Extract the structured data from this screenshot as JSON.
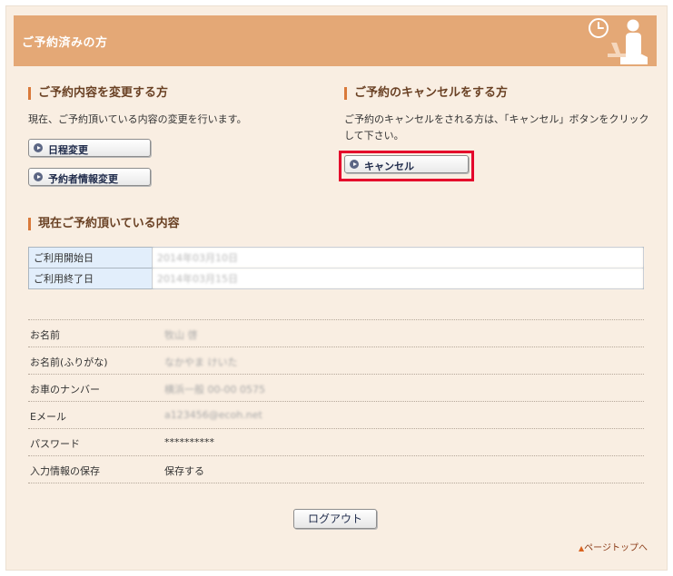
{
  "header": {
    "title": "ご予約済みの方",
    "icon": "seated-person-clock-icon"
  },
  "change_section": {
    "title": "ご予約内容を変更する方",
    "description": "現在、ご予約頂いている内容の変更を行います。",
    "buttons": [
      "日程変更",
      "予約者情報変更"
    ]
  },
  "cancel_section": {
    "title": "ご予約のキャンセルをする方",
    "description_line1": "ご予約のキャンセルをされる方は、「キャンセル」ボタンをクリック",
    "description_line2": "して下さい。",
    "button": "キャンセル",
    "highlight_color": "#e4002b"
  },
  "current_section": {
    "title": "現在ご予約頂いている内容",
    "dates": [
      {
        "label": "ご利用開始日",
        "value": "2014年03月10日"
      },
      {
        "label": "ご利用終了日",
        "value": "2014年03月15日"
      }
    ],
    "info": [
      {
        "label": "お名前",
        "value": "牧山 啓",
        "blurred": true
      },
      {
        "label": "お名前(ふりがな)",
        "value": "なかやま けいた",
        "blurred": true
      },
      {
        "label": "お車のナンバー",
        "value": "横浜一般 00-00 0575",
        "blurred": true
      },
      {
        "label": "Eメール",
        "value": "a123456@ecoh.net",
        "blurred": true
      },
      {
        "label": "パスワード",
        "value": "**********",
        "blurred": false
      },
      {
        "label": "入力情報の保存",
        "value": "保存する",
        "blurred": false
      }
    ]
  },
  "logout_button": "ログアウト",
  "page_top": {
    "arrow": "▲",
    "label": "ページトップへ"
  },
  "colors": {
    "header_bg": "#e4a876",
    "page_bg": "#f9eee2",
    "accent_bar": "#d9793a",
    "table_label_bg": "#e2eefb"
  }
}
